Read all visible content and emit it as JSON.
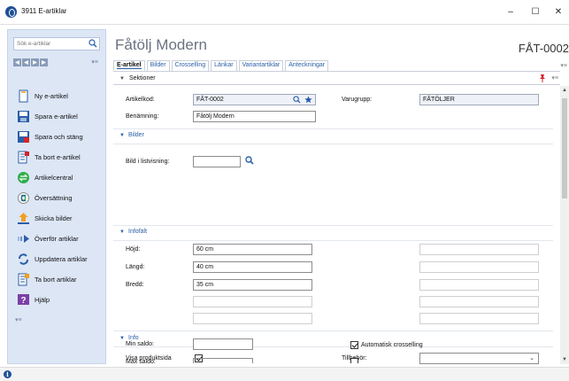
{
  "window": {
    "title": "3911 E-artiklar",
    "minimize": "–",
    "maximize": "☐",
    "close": "✕"
  },
  "sidebar": {
    "search_placeholder": "Sök e-artiklar",
    "menu_glyph": "▾≡",
    "items": [
      {
        "label": "Ny e-artikel",
        "icon": "new-document-icon"
      },
      {
        "label": "Spara e-artikel",
        "icon": "save-icon"
      },
      {
        "label": "Spara och stäng",
        "icon": "save-close-icon"
      },
      {
        "label": "Ta bort e-artikel",
        "icon": "delete-document-icon"
      },
      {
        "label": "Artikelcentral",
        "icon": "central-icon"
      },
      {
        "label": "Översättning",
        "icon": "translate-icon"
      },
      {
        "label": "Skicka bilder",
        "icon": "upload-icon"
      },
      {
        "label": "Överför artiklar",
        "icon": "transfer-icon"
      },
      {
        "label": "Uppdatera artiklar",
        "icon": "refresh-icon"
      },
      {
        "label": "Ta bort artiklar",
        "icon": "delete-articles-icon"
      },
      {
        "label": "Hjälp",
        "icon": "help-icon"
      }
    ]
  },
  "main": {
    "title": "Fåtölj Modern",
    "code": "FÅT-0002",
    "menu_glyph": "▾≡",
    "tabs": [
      {
        "label": "E-artikel",
        "active": true
      },
      {
        "label": "Bilder"
      },
      {
        "label": "Crosselling"
      },
      {
        "label": "Länkar"
      },
      {
        "label": "Variantartiklar"
      },
      {
        "label": "Anteckningar"
      }
    ],
    "sektioner": {
      "caret": "▼",
      "label": "Sektioner",
      "mini": "▾≡"
    }
  },
  "form": {
    "artikelkod_label": "Artikelkod:",
    "artikelkod_value": "FÅT-0002",
    "varugrupp_label": "Varugrupp:",
    "varugrupp_value": "FÅTÖLJER",
    "benamning_label": "Benämning:",
    "benamning_value": "Fåtölj Modern",
    "bilder_head": "Bilder",
    "bild_label": "Bild i listvisning:",
    "infofalt_head": "Infofält",
    "hojd_label": "Höjd:",
    "hojd_value": "60 cm",
    "langd_label": "Längd:",
    "langd_value": "40 cm",
    "bredd_label": "Bredd:",
    "bredd_value": "35 cm",
    "info_head": "Info",
    "visa_label": "Visa produktsida",
    "visa_checked": true,
    "minsaldo_label": "Min saldo:",
    "tillbehor_label": "Tillbehör:",
    "autocross_label": "Automatisk crosselling",
    "autocross_checked": true,
    "partial_label": "Max saldo:"
  },
  "colors": {
    "accent": "#2a5ea8",
    "sidebar_bg": "#dce6f5",
    "brand": "#1f4f96"
  }
}
